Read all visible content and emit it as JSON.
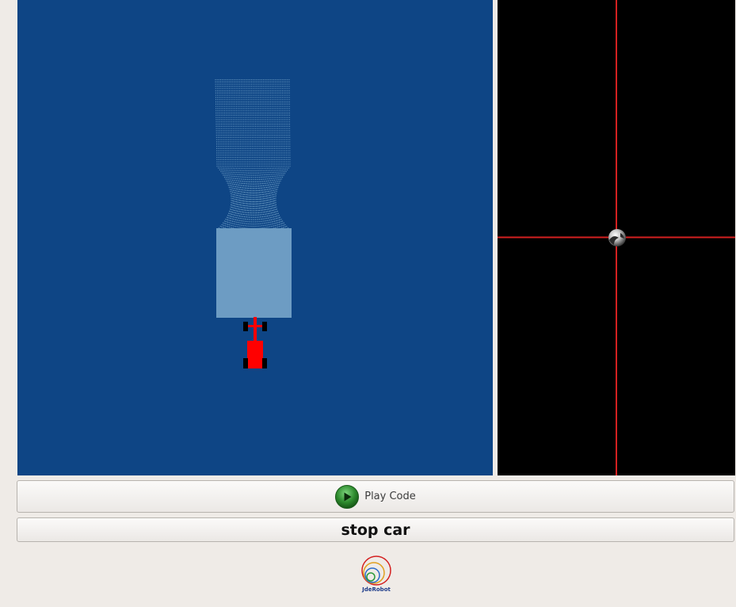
{
  "colors": {
    "map_background": "#0e4585",
    "laser_points": "#6d9cc3",
    "car": "#ff0000",
    "wheels": "#000000",
    "teleop_background": "#000000",
    "crosshair": "#d42020",
    "play_icon": "#2e8b2e",
    "app_background": "#efebe7"
  },
  "controls": {
    "play_label": "Play Code",
    "stop_label": "stop car"
  },
  "teleoperator": {
    "handle_icon": "ball-handle-icon"
  },
  "logo": {
    "text": "JdeRobot"
  }
}
